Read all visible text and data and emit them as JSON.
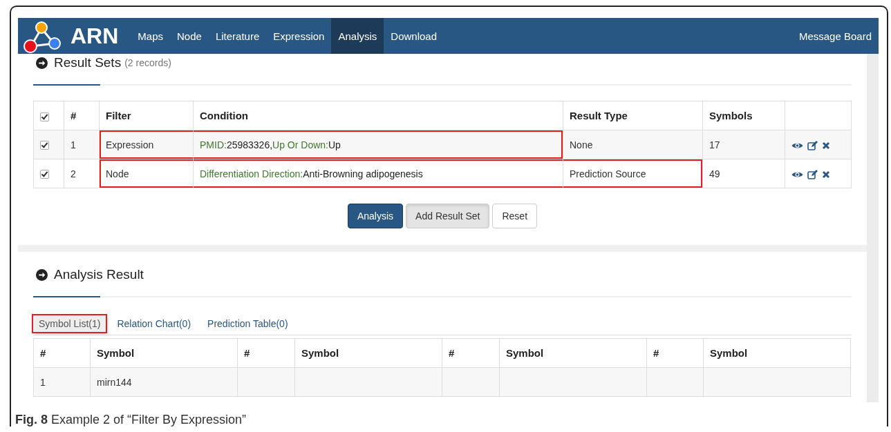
{
  "navbar": {
    "brand": "ARN",
    "items": [
      {
        "label": "Maps",
        "selected": false
      },
      {
        "label": "Node",
        "selected": false
      },
      {
        "label": "Literature",
        "selected": false
      },
      {
        "label": "Expression",
        "selected": false
      },
      {
        "label": "Analysis",
        "selected": true
      },
      {
        "label": "Download",
        "selected": false
      }
    ],
    "right_link": "Message Board"
  },
  "result_sets": {
    "title": "Result Sets",
    "count": "(2 records)",
    "table": {
      "header_checked": true,
      "columns": [
        "#",
        "Filter",
        "Condition",
        "Result Type",
        "Symbols"
      ],
      "rows": [
        {
          "checked": true,
          "number": "1",
          "filter": "Expression",
          "condition": [
            {
              "text": "PMID:",
              "kind": "label"
            },
            {
              "text": "25983326,",
              "kind": "value"
            },
            {
              "text": "Up Or Down:",
              "kind": "label"
            },
            {
              "text": "Up",
              "kind": "value"
            }
          ],
          "result_type": "None",
          "symbols": "17",
          "marked": {
            "filter": true,
            "condition": true,
            "result_type": false
          }
        },
        {
          "checked": true,
          "number": "2",
          "filter": "Node",
          "condition": [
            {
              "text": "Differentiation Direction:",
              "kind": "label"
            },
            {
              "text": "Anti-Browning adipogenesis",
              "kind": "value"
            }
          ],
          "result_type": "Prediction Source",
          "symbols": "49",
          "marked": {
            "filter": true,
            "condition": true,
            "result_type": true
          }
        }
      ]
    },
    "buttons": [
      {
        "label": "Analysis",
        "kind": "primary"
      },
      {
        "label": "Add Result Set",
        "kind": "pressed"
      },
      {
        "label": "Reset",
        "kind": "default"
      }
    ]
  },
  "analysis_result": {
    "title": "Analysis Result",
    "tabs": [
      {
        "label": "Symbol List(1)",
        "selected": true,
        "highlight": true
      },
      {
        "label": "Relation Chart(0)",
        "selected": false,
        "highlight": false
      },
      {
        "label": "Prediction Table(0)",
        "selected": false,
        "highlight": false
      }
    ],
    "table": {
      "columns": [
        "#",
        "Symbol",
        "#",
        "Symbol",
        "#",
        "Symbol",
        "#",
        "Symbol"
      ],
      "rows": [
        [
          "1",
          "mirn144"
        ]
      ]
    }
  },
  "caption": {
    "label": "Fig. 8",
    "text": "Example 2 of “Filter By Expression”"
  }
}
